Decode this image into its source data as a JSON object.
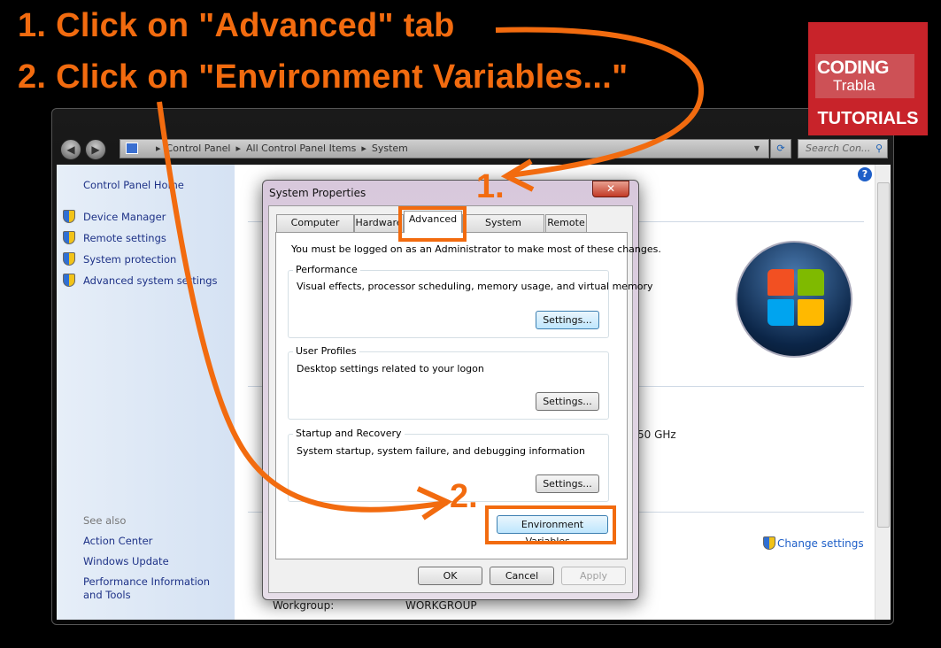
{
  "instructions": [
    "1. Click on \"Advanced\" tab",
    "2. Click on \"Environment Variables...\""
  ],
  "logo": {
    "line1": "CODING",
    "line2": "Trabla",
    "line3": "TUTORIALS"
  },
  "step_markers": [
    "1.",
    "2."
  ],
  "explorer": {
    "breadcrumb": [
      "Control Panel",
      "All Control Panel Items",
      "System"
    ],
    "search_placeholder": "Search Con...",
    "sidebar": {
      "home": "Control Panel Home",
      "items": [
        "Device Manager",
        "Remote settings",
        "System protection",
        "Advanced system settings"
      ],
      "see_also_label": "See also",
      "see_also": [
        "Action Center",
        "Windows Update",
        "Performance Information and Tools"
      ]
    },
    "background": {
      "cpu_fragment": "50 GHz",
      "change_settings": "Change settings",
      "workgroup_label": "Workgroup:",
      "workgroup_value": "WORKGROUP"
    }
  },
  "dialog": {
    "title": "System Properties",
    "tabs": [
      "Computer Name",
      "Hardware",
      "Advanced",
      "System Protection",
      "Remote"
    ],
    "active_tab": "Advanced",
    "admin_note": "You must be logged on as an Administrator to make most of these changes.",
    "groups": [
      {
        "label": "Performance",
        "desc": "Visual effects, processor scheduling, memory usage, and virtual memory",
        "button": "Settings..."
      },
      {
        "label": "User Profiles",
        "desc": "Desktop settings related to your logon",
        "button": "Settings..."
      },
      {
        "label": "Startup and Recovery",
        "desc": "System startup, system failure, and debugging information",
        "button": "Settings..."
      }
    ],
    "env_button": "Environment Variables...",
    "ok": "OK",
    "cancel": "Cancel",
    "apply": "Apply"
  },
  "colors": {
    "accent": "#f26b0f",
    "logo_bg": "#c8232a"
  }
}
